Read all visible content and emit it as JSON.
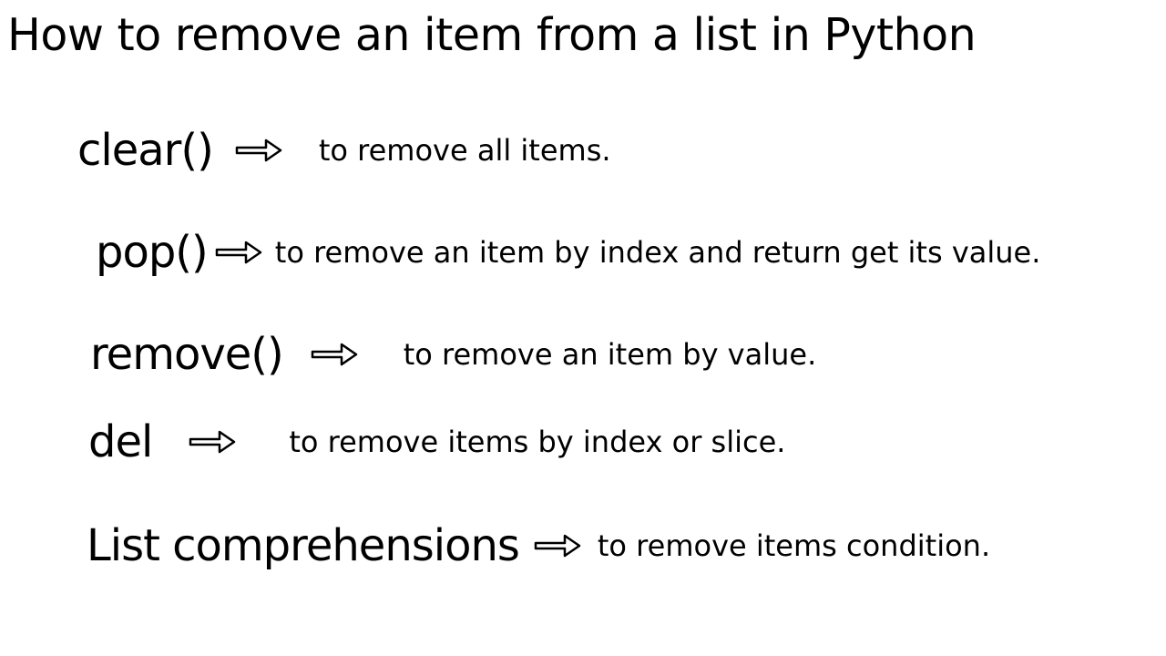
{
  "title": "How to remove an item from a list in Python",
  "items": [
    {
      "method": "clear()",
      "desc": "to remove all items."
    },
    {
      "method": "pop()",
      "desc": "to remove an item by index and return get its value."
    },
    {
      "method": "remove()",
      "desc": "to remove an item by value."
    },
    {
      "method": "del",
      "desc": "to remove items by index or slice."
    },
    {
      "method": "List comprehensions",
      "desc": "to remove items condition."
    }
  ]
}
